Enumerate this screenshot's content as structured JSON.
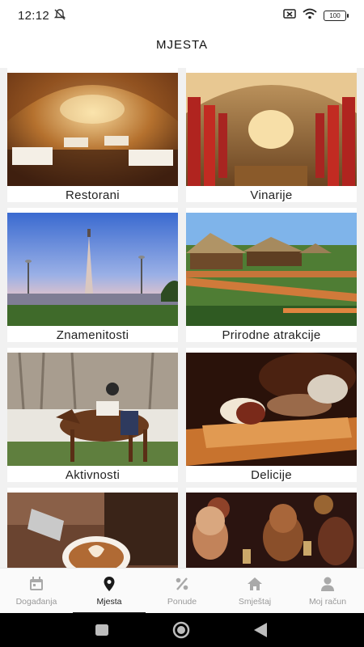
{
  "status": {
    "time": "12:12",
    "battery": "100"
  },
  "header": {
    "title": "MJESTA"
  },
  "categories": [
    {
      "label": "Restorani"
    },
    {
      "label": "Vinarije"
    },
    {
      "label": "Znamenitosti"
    },
    {
      "label": "Prirodne atrakcije"
    },
    {
      "label": "Aktivnosti"
    },
    {
      "label": "Delicije"
    },
    {
      "label": ""
    },
    {
      "label": ""
    }
  ],
  "nav": {
    "items": [
      {
        "label": "Događanja",
        "icon": "calendar-icon"
      },
      {
        "label": "Mjesta",
        "icon": "location-pin-icon"
      },
      {
        "label": "Ponude",
        "icon": "percent-icon"
      },
      {
        "label": "Smještaj",
        "icon": "home-icon"
      },
      {
        "label": "Moj račun",
        "icon": "user-icon"
      }
    ],
    "active": "Mjesta"
  },
  "colors": {
    "active": "#222222",
    "inactive": "#999999",
    "background": "#f1f1f1"
  }
}
